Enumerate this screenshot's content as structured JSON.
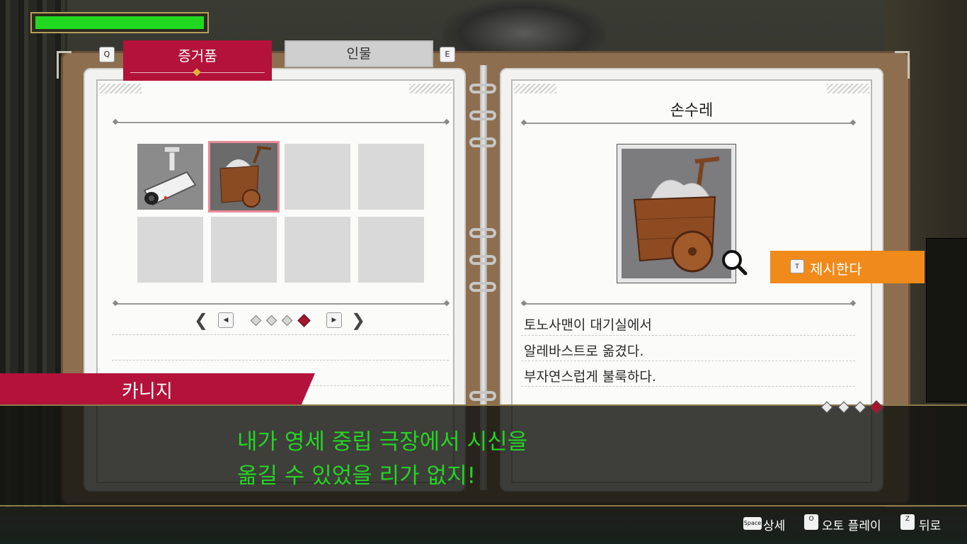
{
  "health": {
    "fraction": 1.0,
    "color": "#21d821"
  },
  "tabs": {
    "prev_key": "Q",
    "next_key": "E",
    "items": [
      {
        "label": "증거품",
        "active": true
      },
      {
        "label": "인물",
        "active": false
      }
    ]
  },
  "evidence": {
    "slots": [
      {
        "icon": "security-camera-icon",
        "filled": true,
        "selected": false
      },
      {
        "icon": "handcart-icon",
        "filled": true,
        "selected": true
      },
      {
        "filled": false
      },
      {
        "filled": false
      },
      {
        "filled": false
      },
      {
        "filled": false
      },
      {
        "filled": false
      },
      {
        "filled": false
      }
    ],
    "pages_total": 4,
    "current_page": 4
  },
  "detail": {
    "title": "손수레",
    "image_icon": "handcart-icon",
    "description": [
      "토노사맨이 대기실에서",
      "알레바스트로 옮겼다.",
      "부자연스럽게 불룩하다."
    ]
  },
  "present": {
    "key": "T",
    "label": "제시한다",
    "color": "#f08a1a"
  },
  "dialogue": {
    "speaker": "카니지",
    "lines": [
      "내가 영세 중립 극장에서 시신을",
      "옮길 수 있었을 리가 없지!"
    ],
    "pages_total": 4,
    "current_page": 4,
    "text_color": "#24d424"
  },
  "controls": [
    {
      "key": "Space",
      "label": "상세"
    },
    {
      "key": "O",
      "label": "오토 플레이"
    },
    {
      "key": "Z",
      "label": "뒤로"
    }
  ]
}
